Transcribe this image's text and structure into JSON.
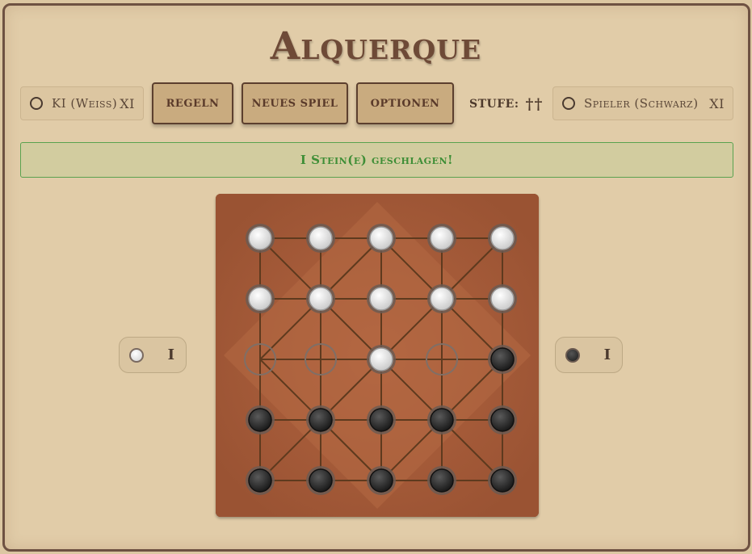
{
  "title": "Alquerque",
  "players": {
    "left": {
      "name": "KI (Weiss)",
      "score": "XI"
    },
    "right": {
      "name": "Spieler (Schwarz)",
      "score": "XI"
    }
  },
  "toolbar": {
    "rules_label": "Regeln",
    "new_game_label": "Neues Spiel",
    "options_label": "Optionen",
    "level_label": "Stufe:",
    "level_value": "††"
  },
  "status_message": "I Stein(e) geschlagen!",
  "captured": {
    "white": "I",
    "black": "I"
  },
  "board": {
    "rows": [
      [
        "W",
        "W",
        "W",
        "W",
        "W"
      ],
      [
        "W",
        "W",
        "W",
        "W",
        "W"
      ],
      [
        "E",
        "E",
        "W",
        "E",
        "B"
      ],
      [
        "B",
        "B",
        "B",
        "B",
        "B"
      ],
      [
        "B",
        "B",
        "B",
        "B",
        "B"
      ]
    ]
  },
  "colors": {
    "white_piece": "#e6e6e6",
    "black_piece": "#2a2a2a",
    "board": "#9a5333",
    "banner_text": "#3e8e36"
  }
}
